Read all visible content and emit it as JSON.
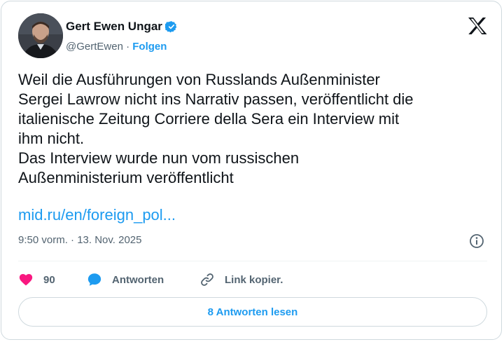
{
  "author": {
    "name": "Gert Ewen Ungar",
    "handle": "@GertEwen",
    "separator": "·",
    "follow_label": "Folgen"
  },
  "tweet": {
    "text": "Weil die Ausführungen von Russlands Außenminister\nSergei Lawrow nicht ins Narrativ passen, veröffentlicht die\nitalienische Zeitung Corriere della Sera ein Interview mit\nihm nicht.\nDas Interview wurde nun vom russischen\nAußenministerium veröffentlicht",
    "link": "mid.ru/en/foreign_pol...",
    "timestamp": "9:50 vorm. · 13. Nov. 2025"
  },
  "actions": {
    "like_count": "90",
    "reply_label": "Antworten",
    "copy_link_label": "Link kopier."
  },
  "read_replies_label": "8 Antworten lesen",
  "icons": {
    "verified": "verified-badge-icon",
    "brand": "x-logo-icon",
    "info": "info-icon",
    "like": "heart-icon",
    "reply": "speech-bubble-icon",
    "copy": "link-icon"
  },
  "colors": {
    "accent": "#1d9bf0",
    "like": "#f91880",
    "text": "#0f1419",
    "muted": "#536471",
    "border": "#cfd9de"
  }
}
